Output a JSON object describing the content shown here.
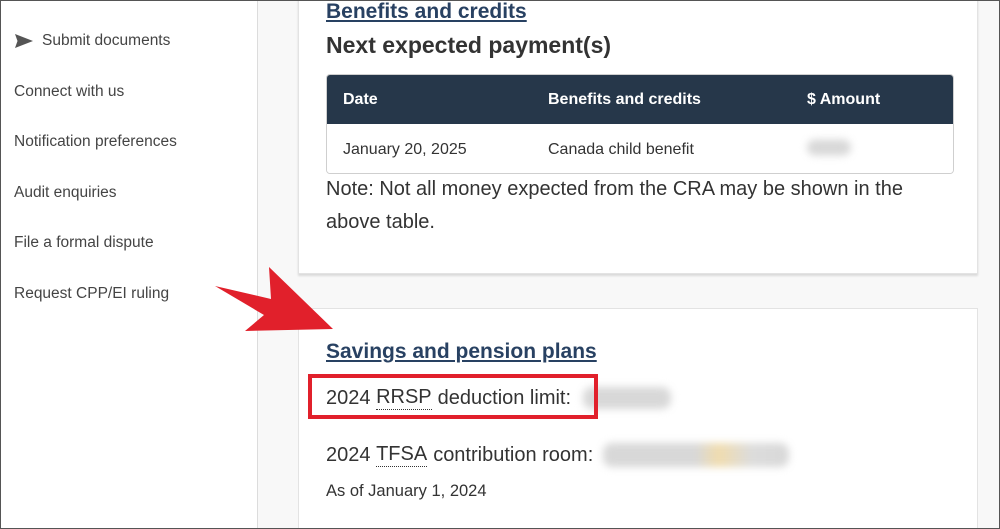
{
  "sidebar": {
    "items": [
      {
        "label": "Submit documents",
        "icon": "send-icon"
      },
      {
        "label": "Connect with us"
      },
      {
        "label": "Notification preferences"
      },
      {
        "label": "Audit enquiries"
      },
      {
        "label": "File a formal dispute"
      },
      {
        "label": "Request CPP/EI ruling"
      }
    ]
  },
  "benefits": {
    "link": "Benefits and credits",
    "heading": "Next expected payment(s)",
    "table": {
      "headers": [
        "Date",
        "Benefits and credits",
        "$ Amount"
      ],
      "rows": [
        {
          "date": "January 20, 2025",
          "benefit": "Canada child benefit",
          "amount": ""
        }
      ]
    },
    "note": "Note: Not all money expected from the CRA may be shown in the above table."
  },
  "savings": {
    "link": "Savings and pension plans",
    "rrsp": {
      "prefix": "2024",
      "abbr": "RRSP",
      "suffix": "deduction limit:",
      "value": ""
    },
    "tfsa": {
      "prefix": "2024",
      "abbr": "TFSA",
      "suffix": "contribution room:",
      "value": ""
    },
    "as_of": "As of January 1, 2024"
  },
  "colors": {
    "link": "#284162",
    "table_header": "#26374a",
    "annotation_red": "#e1202b"
  }
}
